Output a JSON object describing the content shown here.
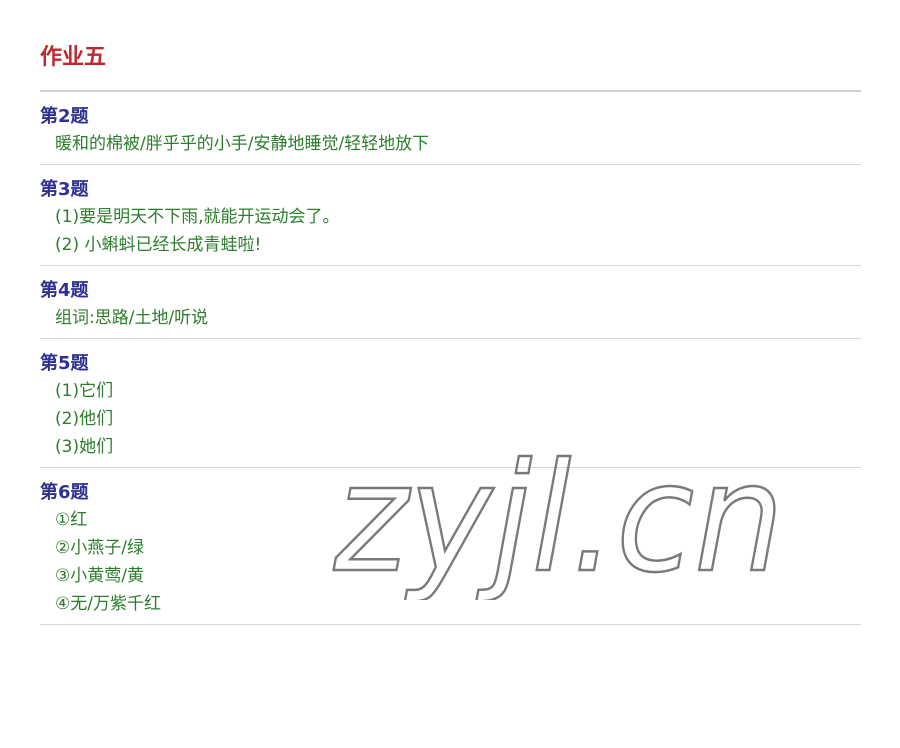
{
  "title": "作业五",
  "sections": [
    {
      "heading": "第2题",
      "answers": [
        "暖和的棉被/胖乎乎的小手/安静地睡觉/轻轻地放下"
      ]
    },
    {
      "heading": "第3题",
      "answers": [
        "(1)要是明天不下雨,就能开运动会了。",
        "(2) 小蝌蚪已经长成青蛙啦!"
      ]
    },
    {
      "heading": "第4题",
      "answers": [
        "组词:思路/土地/听说"
      ]
    },
    {
      "heading": "第5题",
      "answers": [
        "(1)它们",
        "(2)他们",
        "(3)她们"
      ]
    },
    {
      "heading": "第6题",
      "answers": [
        "①红",
        "②小燕子/绿",
        "③小黄莺/黄",
        "④无/万紫千红"
      ]
    }
  ],
  "watermark": "zyjl.cn",
  "colors": {
    "title": "#c0272d",
    "heading": "#2e3192",
    "answer": "#2d7d2d",
    "rule": "#d6d6d6"
  }
}
